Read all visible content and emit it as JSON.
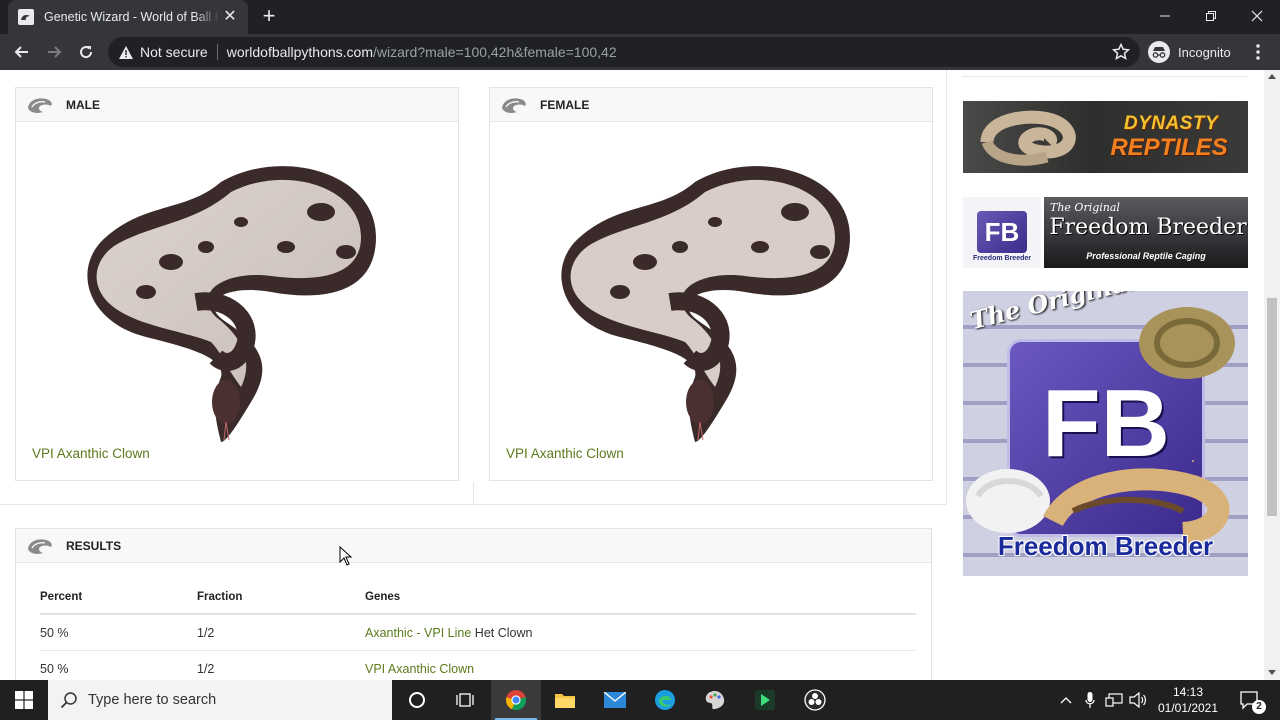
{
  "browser": {
    "tab_title": "Genetic Wizard - World of Ball Pythons",
    "new_tab": "+",
    "omnibox": {
      "security_label": "Not secure",
      "host": "worldofballpythons.com",
      "path": "/wizard?male=100,42h&female=100,42"
    },
    "profile_label": "Incognito"
  },
  "page": {
    "male_panel": {
      "title": "MALE",
      "morph": "VPI Axanthic Clown"
    },
    "female_panel": {
      "title": "FEMALE",
      "morph": "VPI Axanthic Clown"
    },
    "results": {
      "title": "RESULTS",
      "columns": [
        "Percent",
        "Fraction",
        "Genes"
      ],
      "rows": [
        {
          "percent": "50 %",
          "fraction": "1/2",
          "genes_link": "Axanthic - VPI Line",
          "genes_rest": " Het Clown"
        },
        {
          "percent": "50 %",
          "fraction": "1/2",
          "genes_link": "VPI Axanthic Clown",
          "genes_rest": ""
        }
      ]
    },
    "ads": {
      "dynasty": {
        "text_line1": "DYNASTY",
        "text_line2": "REPTILES"
      },
      "fb_banner": {
        "logo": "FB",
        "logo_sub": "Freedom Breeder",
        "tagline_top": "The Original",
        "brand": "Freedom Breeder",
        "subtitle": "Professional Reptile Caging"
      },
      "fb_big": {
        "tagline": "The Original",
        "logo": "FB",
        "brand": "Freedom Breeder"
      }
    },
    "accent_color": "#5b7a1c"
  },
  "taskbar": {
    "search_placeholder": "Type here to search",
    "time": "14:13",
    "date": "01/01/2021",
    "notification_count": "2"
  }
}
